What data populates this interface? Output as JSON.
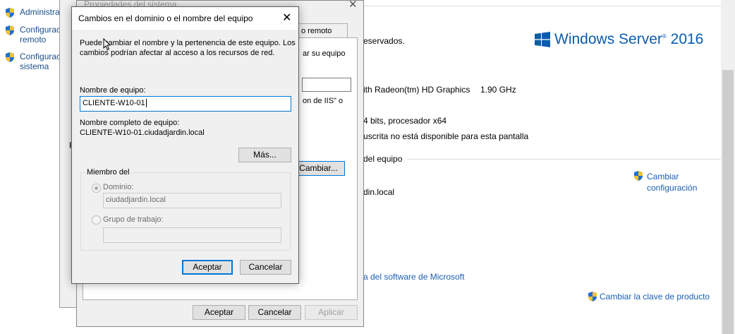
{
  "left_nav": {
    "items": [
      {
        "label": "Administra",
        "icon": "shield-icon"
      },
      {
        "label": "Configuraci remoto",
        "icon": "shield-icon"
      },
      {
        "label": "Configuraci sistema",
        "icon": "shield-icon"
      }
    ],
    "item_lines": [
      [
        "Administra"
      ],
      [
        "Configuraci",
        "remoto"
      ],
      [
        "Configuraci",
        "sistema"
      ]
    ]
  },
  "background": {
    "copyright_text": "eservados.",
    "logo_text": "Windows Server",
    "logo_version": "2016",
    "processor_text": "ith Radeon(tm) HD Graphics",
    "processor_speed": "1.90 GHz",
    "system_type": "4 bits, procesador x64",
    "pen_touch": "uscrita no está disponible para esta pantalla",
    "section_domain": "del equipo",
    "domain_value": "din.local",
    "change_settings_link_1": "Cambiar",
    "change_settings_link_2": "configuración",
    "license_link": "a del software de Microsoft",
    "product_key_link": "Cambiar la clave de producto"
  },
  "system_properties": {
    "title": "Propiedades del sistema",
    "tab_label": "o remoto",
    "partial_text_1": "ar su equipo",
    "partial_text_2": "on de IIS\" o",
    "partial_letter": "F",
    "change_button": "Cambiar...",
    "ok_button": "Aceptar",
    "cancel_button": "Cancelar",
    "apply_button": "Aplicar"
  },
  "dialog": {
    "title": "Cambios en el dominio o el nombre del equipo",
    "description": "Puede cambiar el nombre y la pertenencia de este equipo. Los cambios podrían afectar al acceso a los recursos de red.",
    "description_lines": [
      "Puede cambiar el nombre y la pertenencia de este equipo. Los",
      "cambios podrían afectar al acceso a los recursos de red."
    ],
    "computer_name_label": "Nombre de equipo:",
    "computer_name_value": "CLIENTE-W10-01",
    "full_name_label": "Nombre completo de equipo:",
    "full_name_value": "CLIENTE-W10-01.ciudadjardin.local",
    "more_button": "Más...",
    "member_of_label": "Miembro del",
    "domain_radio_label": "Dominio:",
    "domain_value": "ciudadjardin.local",
    "workgroup_radio_label": "Grupo de trabajo:",
    "workgroup_value": "",
    "ok_button": "Aceptar",
    "cancel_button": "Cancelar"
  },
  "colors": {
    "link": "#1a5fb4",
    "accent": "#0078d7",
    "windows_logo": "#0b5cad"
  }
}
